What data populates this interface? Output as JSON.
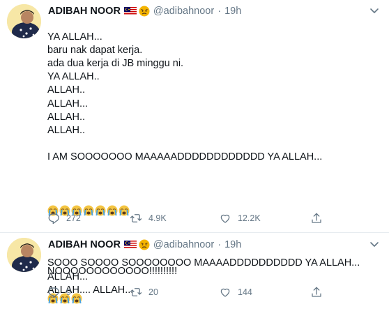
{
  "tweets": [
    {
      "author": {
        "name": "ADIBAH NOOR",
        "handle": "@adibahnoor",
        "time": "19h"
      },
      "lines_a": "YA ALLAH...\nbaru nak dapat kerja.\nada dua kerja di JB minggu ni.\nYA ALLAH..\nALLAH..\nALLAH...\nALLAH..\nALLAH..\n\nI AM SOOOOOOO MAAAAADDDDDDDDDDDD YA ALLAH...",
      "emoji_row_1": [
        "crying-face",
        "crying-face",
        "crying-face",
        "crying-face",
        "crying-face",
        "crying-face",
        "crying-face"
      ],
      "lines_b": "SOOO SOOOO SOOOOOOOO MAAAADDDDDDDDDD YA ALLAH... ALLAH...\nALLAH.... ALLAH...",
      "stats": {
        "replies": "272",
        "retweets": "4.9K",
        "likes": "12.2K"
      }
    },
    {
      "author": {
        "name": "ADIBAH NOOR",
        "handle": "@adibahnoor",
        "time": "19h"
      },
      "lines_a": "NOOOOOOOOOOOO!!!!!!!!!!",
      "emoji_row_1": [
        "crying-face",
        "crying-face",
        "crying-face"
      ],
      "stats": {
        "replies": "9",
        "retweets": "20",
        "likes": "144"
      }
    }
  ],
  "colors": {
    "text": "#0f1419",
    "muted": "#657786",
    "divider": "#e6ecf0",
    "avatar_bg": "#f7e7a6"
  },
  "icons": [
    "reply-icon",
    "retweet-icon",
    "like-icon",
    "share-icon",
    "caret-down-icon",
    "malaysia-flag-icon",
    "pouting-face-icon",
    "crying-face-icon"
  ]
}
